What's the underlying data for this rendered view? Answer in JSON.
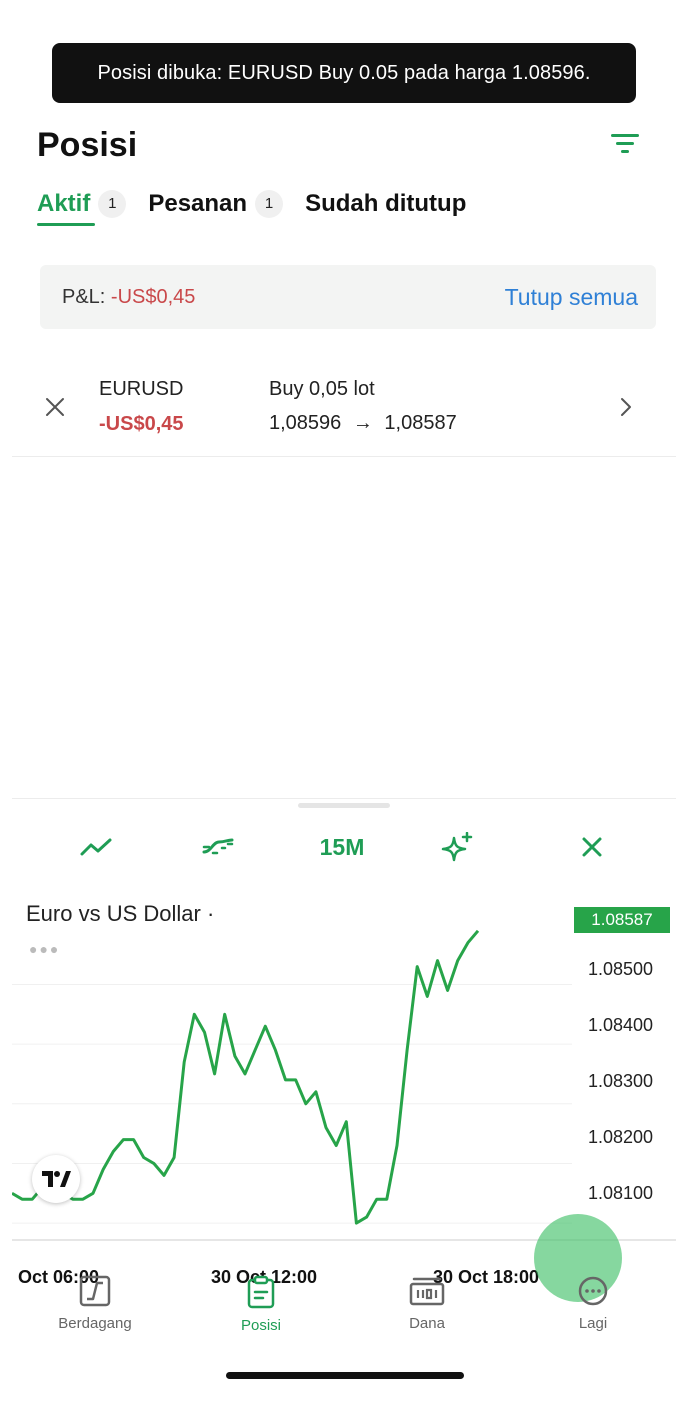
{
  "toast": {
    "message": "Posisi dibuka: EURUSD Buy 0.05 pada harga 1.08596."
  },
  "header": {
    "title": "Posisi",
    "filter_icon": "filter-icon"
  },
  "tabs": [
    {
      "label": "Aktif",
      "count": "1"
    },
    {
      "label": "Pesanan",
      "count": "1"
    },
    {
      "label": "Sudah ditutup",
      "count": ""
    }
  ],
  "summary": {
    "pl_label": "P&L:",
    "pl_value": "-US$0,45",
    "close_all": "Tutup semua"
  },
  "positions": [
    {
      "symbol": "EURUSD",
      "pl": "-US$0,45",
      "side": "Buy 0,05 lot",
      "open_price": "1,08596",
      "arrow": "→",
      "current_price": "1,08587"
    }
  ],
  "chart_toolbar": {
    "timeframe": "15M"
  },
  "chart_data": {
    "type": "line",
    "title": "Euro vs US Dollar ·",
    "current_price": "1.08587",
    "y_ticks": [
      "1.08500",
      "1.08400",
      "1.08300",
      "1.08200",
      "1.08100"
    ],
    "x_ticks": [
      "Oct 06:00",
      "30 Oct 12:00",
      "30 Oct 18:00"
    ],
    "ylim": [
      1.0807,
      1.0866
    ],
    "series": [
      {
        "values": [
          1.0815,
          1.0814,
          1.0814,
          1.0816,
          1.0815,
          1.0815,
          1.0814,
          1.0814,
          1.0815,
          1.0819,
          1.0822,
          1.0824,
          1.0824,
          1.0821,
          1.082,
          1.0818,
          1.0821,
          1.0837,
          1.0845,
          1.0842,
          1.0835,
          1.0845,
          1.0838,
          1.0835,
          1.0839,
          1.0843,
          1.0839,
          1.0834,
          1.0834,
          1.083,
          1.0832,
          1.0826,
          1.0823,
          1.0827,
          1.081,
          1.0811,
          1.0814,
          1.0814,
          1.0823,
          1.0839,
          1.0853,
          1.0848,
          1.0854,
          1.0849,
          1.0854,
          1.0857,
          1.0859
        ]
      }
    ],
    "colors": {
      "line": "#27a449"
    }
  },
  "bottom_nav": [
    {
      "label": "Berdagang",
      "icon": "trade-chart-icon"
    },
    {
      "label": "Posisi",
      "icon": "clipboard-icon"
    },
    {
      "label": "Dana",
      "icon": "banknote-icon"
    },
    {
      "label": "Lagi",
      "icon": "more-icon"
    }
  ]
}
